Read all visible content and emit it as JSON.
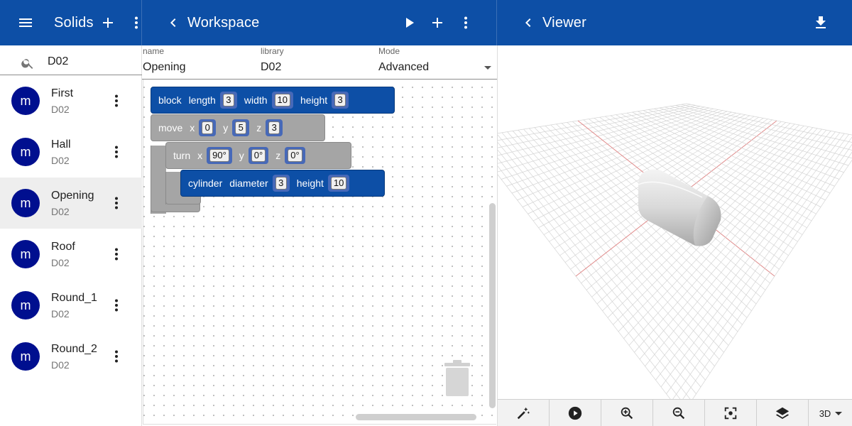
{
  "colors": {
    "primary": "#0d4fa6",
    "avatar": "#000f8f",
    "block_gray": "#a5a5a5"
  },
  "left_bar": {
    "title": "Solids",
    "icons": [
      "menu-icon",
      "add-icon",
      "more-vert-icon"
    ]
  },
  "search": {
    "value": "D02",
    "icon": "search-icon"
  },
  "solids": [
    {
      "avatar": "m",
      "name": "First",
      "library": "D02",
      "selected": false
    },
    {
      "avatar": "m",
      "name": "Hall",
      "library": "D02",
      "selected": false
    },
    {
      "avatar": "m",
      "name": "Opening",
      "library": "D02",
      "selected": true
    },
    {
      "avatar": "m",
      "name": "Roof",
      "library": "D02",
      "selected": false
    },
    {
      "avatar": "m",
      "name": "Round_1",
      "library": "D02",
      "selected": false
    },
    {
      "avatar": "m",
      "name": "Round_2",
      "library": "D02",
      "selected": false
    }
  ],
  "workspace": {
    "title": "Workspace",
    "fields": {
      "name": {
        "label": "name",
        "value": "Opening"
      },
      "library": {
        "label": "library",
        "value": "D02"
      },
      "mode": {
        "label": "Mode",
        "value": "Advanced"
      }
    },
    "blocks": {
      "block": {
        "keyword": "block",
        "length_label": "length",
        "length": "3",
        "width_label": "width",
        "width": "10",
        "height_label": "height",
        "height": "3"
      },
      "move": {
        "keyword": "move",
        "x_label": "x",
        "x": "0",
        "y_label": "y",
        "y": "5",
        "z_label": "z",
        "z": "3"
      },
      "turn": {
        "keyword": "turn",
        "x_label": "x",
        "x": "90°",
        "y_label": "y",
        "y": "0°",
        "z_label": "z",
        "z": "0°"
      },
      "cylinder": {
        "keyword": "cylinder",
        "diameter_label": "diameter",
        "diameter": "3",
        "height_label": "height",
        "height": "10"
      }
    }
  },
  "viewer": {
    "title": "Viewer",
    "toolbar": {
      "view_mode": "3D"
    }
  }
}
